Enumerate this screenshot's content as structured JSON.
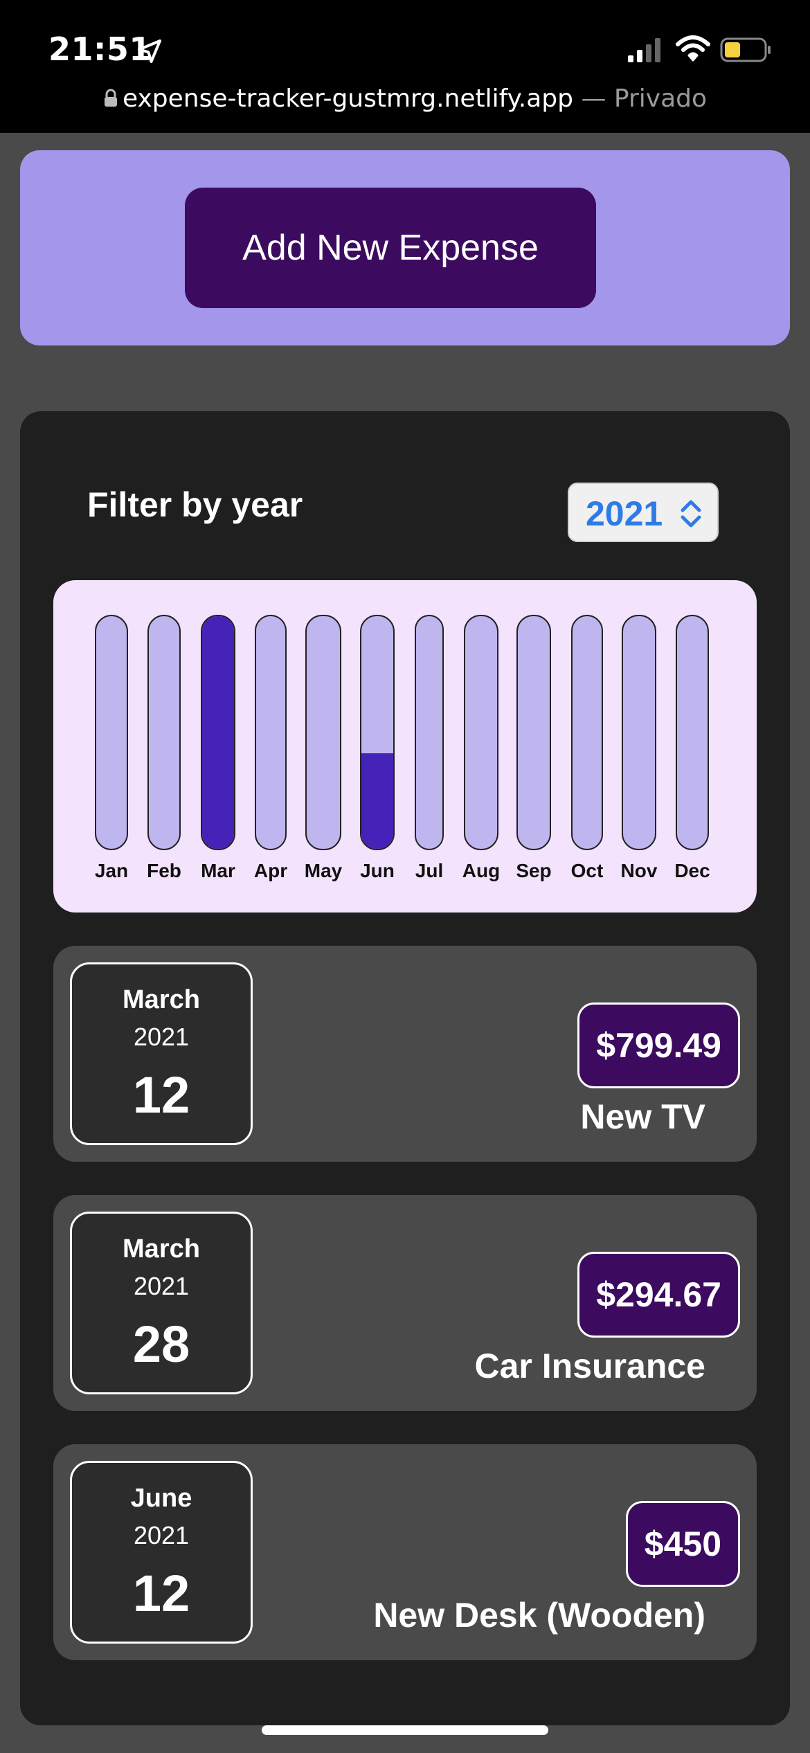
{
  "status_bar": {
    "time": "21:51",
    "url": "expense-tracker-gustmrg.netlify.app",
    "privacy_label": "— Privado"
  },
  "add_expense": {
    "button_label": "Add New Expense"
  },
  "filter": {
    "label": "Filter by year",
    "selected_year": "2021"
  },
  "chart_data": {
    "type": "bar",
    "categories": [
      "Jan",
      "Feb",
      "Mar",
      "Apr",
      "May",
      "Jun",
      "Jul",
      "Aug",
      "Sep",
      "Oct",
      "Nov",
      "Dec"
    ],
    "values": [
      0,
      0,
      1094.16,
      0,
      0,
      450,
      0,
      0,
      0,
      0,
      0,
      0
    ],
    "ylim": [
      0,
      1094.16
    ],
    "grid": false,
    "colors": {
      "track": "#c0b6ef",
      "fill": "#4623b8",
      "background": "#f4e3fd"
    }
  },
  "expenses": [
    {
      "month": "March",
      "year": "2021",
      "day": "12",
      "amount": "$799.49",
      "title": "New TV"
    },
    {
      "month": "March",
      "year": "2021",
      "day": "28",
      "amount": "$294.67",
      "title": "Car Insurance"
    },
    {
      "month": "June",
      "year": "2021",
      "day": "12",
      "amount": "$450",
      "title": "New Desk (Wooden)"
    }
  ],
  "colors": {
    "add_panel": "#a496ea",
    "add_button": "#3c0b5f",
    "card": "#1f1f1f",
    "item": "#4a4a4a",
    "year_text": "#2f7be6"
  }
}
